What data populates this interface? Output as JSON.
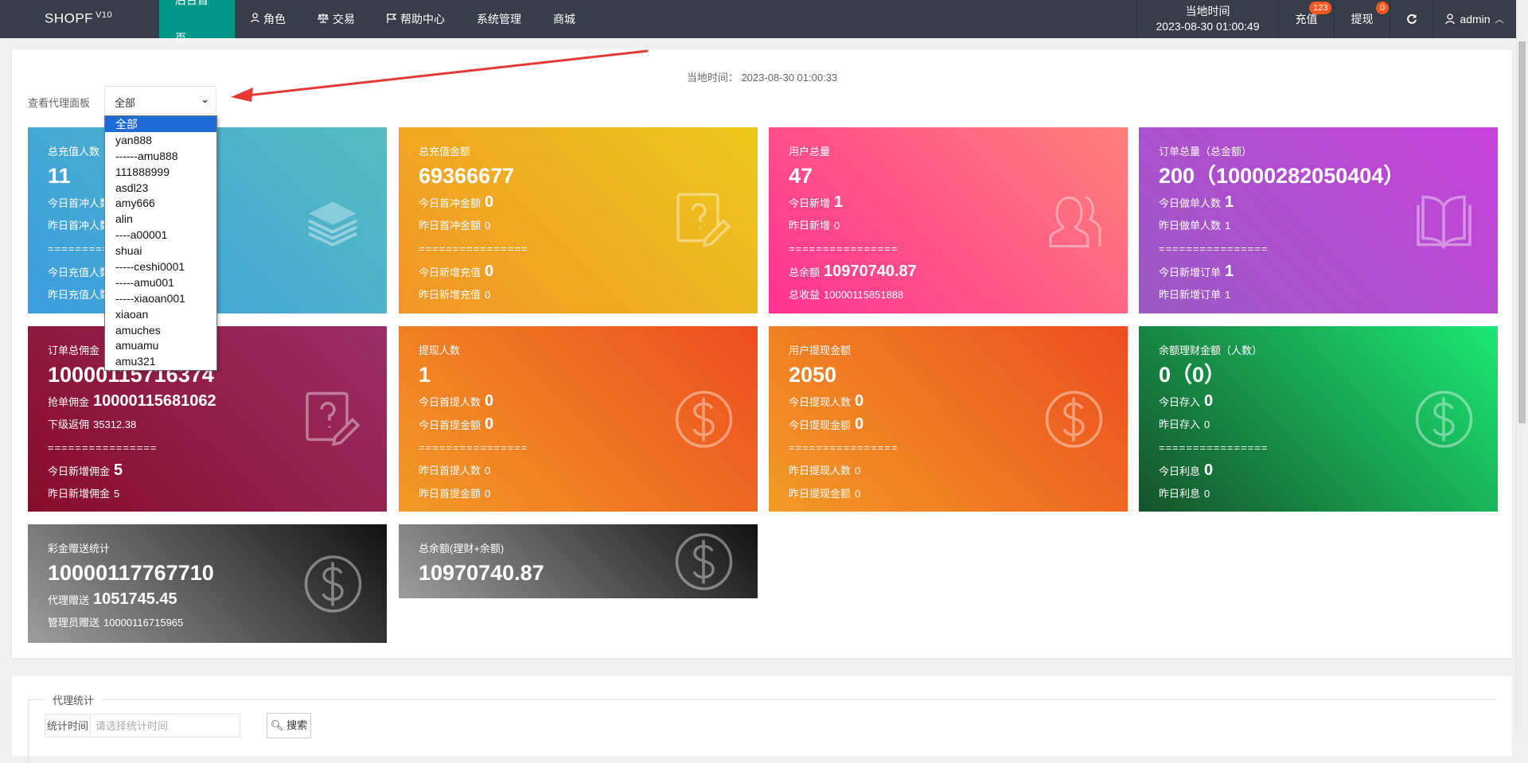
{
  "header": {
    "logo": "SHOPF",
    "logo_version": "V10",
    "nav": [
      {
        "label": "后台首页",
        "icon": "",
        "active": true
      },
      {
        "label": "角色",
        "icon": "user-icon"
      },
      {
        "label": "交易",
        "icon": "scale-icon"
      },
      {
        "label": "帮助中心",
        "icon": "flag-icon"
      },
      {
        "label": "系统管理",
        "icon": ""
      },
      {
        "label": "商城",
        "icon": ""
      }
    ],
    "time_label": "当地时间",
    "time_value": "2023-08-30 01:00:49",
    "recharge_label": "充值",
    "recharge_badge": "123",
    "withdraw_label": "提现",
    "withdraw_badge": "0",
    "user": "admin"
  },
  "panel": {
    "local_time": "当地时间： 2023-08-30 01:00:33",
    "agent_label": "查看代理面板",
    "agent_selected": "全部",
    "agent_options": [
      "全部",
      "yan888",
      "------amu888",
      "111888999",
      "asdl23",
      "amy666",
      "alin",
      "----a00001",
      "shuai",
      "-----ceshi0001",
      "-----amu001",
      "-----xiaoan001",
      "xiaoan",
      "amuches",
      "amuamu",
      "amu321"
    ]
  },
  "separator": "================",
  "cards": [
    {
      "title": "总充值人数",
      "big": "11",
      "icon": "layers-icon",
      "colors": [
        "#3a9de0",
        "#56bcc0"
      ],
      "lines": [
        {
          "label": "今日首冲人数",
          "value": "",
          "bold": true
        },
        {
          "label": "昨日首冲人数",
          "value": ""
        },
        {
          "sep": true
        },
        {
          "label": "今日充值人数",
          "value": "",
          "bold": true
        },
        {
          "label": "昨日充值人数",
          "value": ""
        }
      ]
    },
    {
      "title": "总充值金额",
      "big": "69366677",
      "icon": "question-edit-icon",
      "colors": [
        "#f29526",
        "#ecc81c"
      ],
      "lines": [
        {
          "label": "今日首冲金额",
          "value": "0",
          "bold": true
        },
        {
          "label": "昨日首冲金额",
          "value": "0"
        },
        {
          "sep": true
        },
        {
          "label": "今日新增充值",
          "value": "0",
          "bold": true
        },
        {
          "label": "昨日新增充值",
          "value": "0"
        }
      ]
    },
    {
      "title": "用户总量",
      "big": "47",
      "icon": "users-icon",
      "colors": [
        "#ff3293",
        "#ff807a"
      ],
      "lines": [
        {
          "label": "今日新增",
          "value": "1",
          "bold": true
        },
        {
          "label": "昨日新增",
          "value": "0"
        },
        {
          "sep": true
        },
        {
          "label": "总余额",
          "value": "10970740.87",
          "bold": true
        },
        {
          "label": "总收益",
          "value": "10000115851888"
        }
      ]
    },
    {
      "title": "订单总量（总金额）",
      "big": "200（10000282050404）",
      "icon": "book-icon",
      "colors": [
        "#9b59c5",
        "#c642d9"
      ],
      "lines": [
        {
          "label": "今日做单人数",
          "value": "1",
          "bold": true
        },
        {
          "label": "昨日做单人数",
          "value": "1"
        },
        {
          "sep": true
        },
        {
          "label": "今日新增订单",
          "value": "1",
          "bold": true
        },
        {
          "label": "昨日新增订单",
          "value": "1"
        }
      ]
    },
    {
      "title": "订单总佣金",
      "big": "10000115716374",
      "icon": "question-edit-icon",
      "colors": [
        "#880c2a",
        "#9c2e66"
      ],
      "lines": [
        {
          "label": "抢单佣金",
          "value": "10000115681062",
          "bold": true
        },
        {
          "label": "下级返佣",
          "value": "35312.38"
        },
        {
          "sep": true
        },
        {
          "label": "今日新增佣金",
          "value": "5",
          "bold": true
        },
        {
          "label": "昨日新增佣金",
          "value": "5"
        }
      ]
    },
    {
      "title": "提现人数",
      "big": "1",
      "icon": "dollar-icon",
      "colors": [
        "#f39a25",
        "#ec4d1f"
      ],
      "lines": [
        {
          "label": "今日首提人数",
          "value": "0",
          "bold": true
        },
        {
          "label": "今日首提金额",
          "value": "0",
          "bold": true
        },
        {
          "sep": true
        },
        {
          "label": "昨日首提人数",
          "value": "0"
        },
        {
          "label": "昨日首提金额",
          "value": "0"
        }
      ]
    },
    {
      "title": "用户提现金额",
      "big": "2050",
      "icon": "dollar-icon",
      "colors": [
        "#f39a25",
        "#ec4d1f"
      ],
      "lines": [
        {
          "label": "今日提现人数",
          "value": "0",
          "bold": true
        },
        {
          "label": "今日提现金额",
          "value": "0",
          "bold": true
        },
        {
          "sep": true
        },
        {
          "label": "昨日提现人数",
          "value": "0"
        },
        {
          "label": "昨日提现金额",
          "value": "0"
        }
      ]
    },
    {
      "title": "余额理财金额（人数）",
      "big": "0（0）",
      "icon": "dollar-icon",
      "colors": [
        "#15522a",
        "#1be874"
      ],
      "lines": [
        {
          "label": "今日存入",
          "value": "0",
          "bold": true
        },
        {
          "label": "昨日存入",
          "value": "0"
        },
        {
          "sep": true
        },
        {
          "label": "今日利息",
          "value": "0",
          "bold": true
        },
        {
          "label": "昨日利息",
          "value": "0"
        }
      ]
    },
    {
      "title": "彩金赠送统计",
      "big": "10000117767710",
      "icon": "dollar-icon",
      "colors": [
        "#9d9d9d",
        "#111111"
      ],
      "lines": [
        {
          "label": "代理赠送",
          "value": "1051745.45",
          "bold": true
        },
        {
          "label": "管理员赠送",
          "value": "10000116715965"
        }
      ]
    },
    {
      "title": "总余额(理财+余额)",
      "big": "10970740.87",
      "icon": "dollar-icon",
      "colors": [
        "#9d9d9d",
        "#111111"
      ],
      "lines": []
    }
  ],
  "agent_stats": {
    "legend": "代理统计",
    "time_label": "统计时间",
    "time_placeholder": "请选择统计时间",
    "search_label": "搜索"
  }
}
